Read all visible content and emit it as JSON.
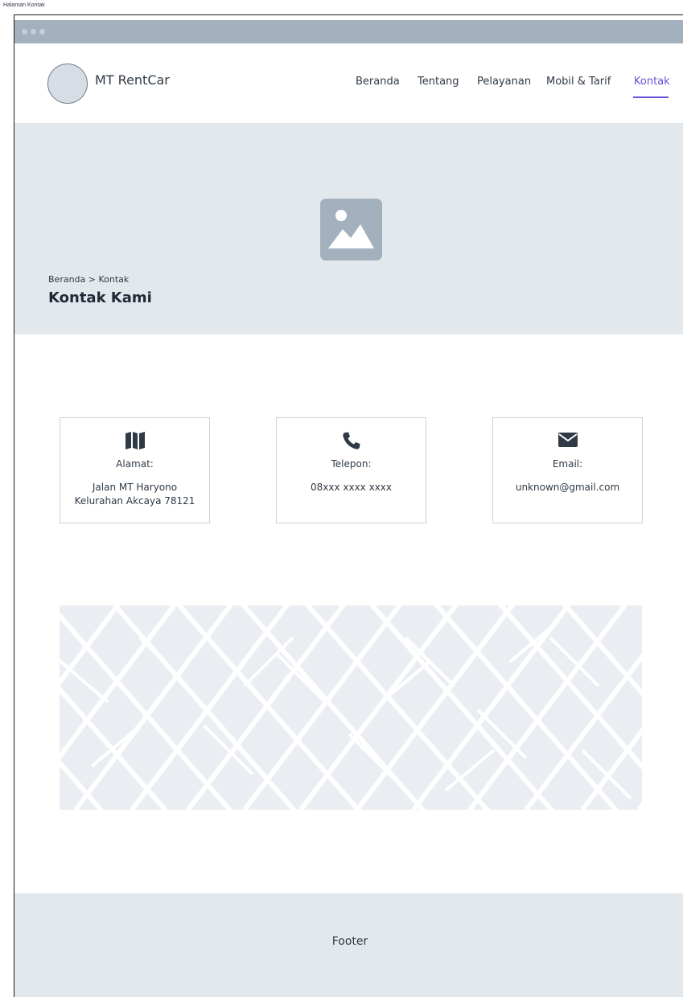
{
  "frame": {
    "label": "Halaman Kontak"
  },
  "header": {
    "brand": "MT RentCar",
    "nav": [
      {
        "label": "Beranda"
      },
      {
        "label": "Tentang"
      },
      {
        "label": "Pelayanan"
      },
      {
        "label": "Mobil & Tarif"
      },
      {
        "label": "Kontak",
        "active": true
      }
    ],
    "accent_color": "#6a4fd8"
  },
  "hero": {
    "breadcrumb": "Beranda > Kontak",
    "title": "Kontak Kami",
    "image_icon": "image-placeholder-icon"
  },
  "contacts": [
    {
      "icon": "map-icon",
      "label": "Alamat:",
      "value_line1": "Jalan MT Haryono",
      "value_line2": "Kelurahan Akcaya 78121"
    },
    {
      "icon": "phone-icon",
      "label": "Telepon:",
      "value_line1": "08xxx xxxx xxxx"
    },
    {
      "icon": "envelope-icon",
      "label": "Email:",
      "value_line1": "unknown@gmail.com"
    }
  ],
  "footer": {
    "text": "Footer"
  }
}
